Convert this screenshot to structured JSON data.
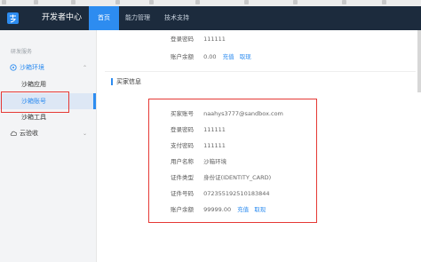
{
  "bookmarks": [
    "",
    "",
    "",
    "",
    "",
    "",
    "",
    "",
    "",
    ""
  ],
  "topnav": {
    "logo_sub": "",
    "brand": "开发者中心",
    "tabs": [
      "首页",
      "能力管理",
      "技术支持"
    ]
  },
  "sidebar": {
    "group_label": "研发服务",
    "sandbox_env": "沙箱环境",
    "items": [
      "沙箱应用",
      "沙箱账号",
      "沙箱工具"
    ],
    "cloud": "云验收"
  },
  "seller": {
    "rows": [
      {
        "label": "登录密码",
        "value": "111111"
      },
      {
        "label": "账户余额",
        "value": "0.00",
        "links": [
          "充值",
          "取现"
        ]
      }
    ]
  },
  "buyer": {
    "title": "买家信息",
    "rows": [
      {
        "label": "买家账号",
        "value": "naahys3777@sandbox.com"
      },
      {
        "label": "登录密码",
        "value": "111111"
      },
      {
        "label": "支付密码",
        "value": "111111"
      },
      {
        "label": "用户名称",
        "value": "沙箱环境"
      },
      {
        "label": "证件类型",
        "value": "身份证(IDENTITY_CARD)"
      },
      {
        "label": "证件号码",
        "value": "072355192510183844"
      },
      {
        "label": "账户余额",
        "value": "99999.00",
        "links": [
          "充值",
          "取现"
        ]
      }
    ]
  },
  "colors": {
    "accent": "#2d8cf0",
    "nav_bg": "#1c2b3d",
    "highlight_border": "#e53935"
  }
}
